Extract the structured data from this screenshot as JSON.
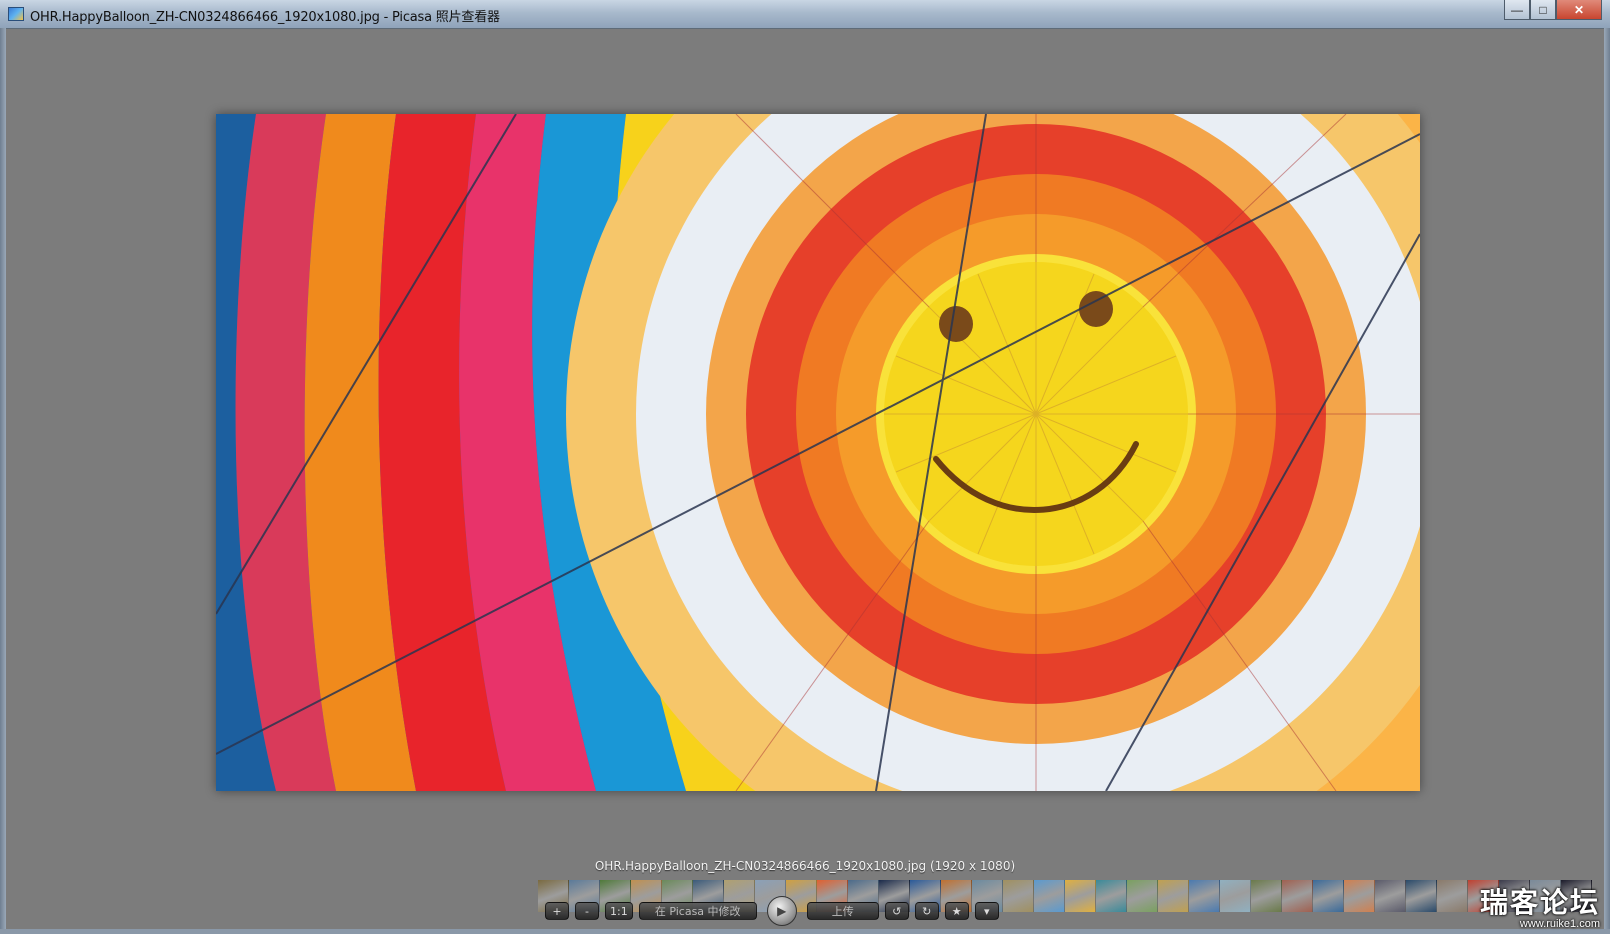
{
  "window": {
    "title": "OHR.HappyBalloon_ZH-CN0324866466_1920x1080.jpg - Picasa 照片查看器",
    "minimize": "—",
    "maximize": "□",
    "close": "✕"
  },
  "viewer": {
    "caption": "OHR.HappyBalloon_ZH-CN0324866466_1920x1080.jpg (1920 x 1080)"
  },
  "controls": {
    "zoom_in": "+",
    "zoom_out": "-",
    "actual_size": "1:1",
    "edit_in_picasa": "在 Picasa 中修改",
    "play": "▶",
    "upload": "上传",
    "rotate_left": "↺",
    "rotate_right": "↻",
    "star": "★",
    "more": "▾"
  },
  "filmstrip": {
    "thumb_colors": [
      "#7a6a40",
      "#5a7a9a",
      "#4f7a3a",
      "#c09050",
      "#6a8a5a",
      "#3a5a7a",
      "#b0a070",
      "#8aa0b8",
      "#d0a040",
      "#e06030",
      "#4a6a8a",
      "#1a2a4a",
      "#2a5a9a",
      "#c07030",
      "#6a8aa0",
      "#a09060",
      "#5a9ad0",
      "#e0b040",
      "#3a8a9a",
      "#7aa060",
      "#c0a050",
      "#4a7ab0",
      "#90b0c0",
      "#6a7a4a",
      "#a06050",
      "#3a6a9a",
      "#d08050",
      "#5a5a6a",
      "#2a4a6a",
      "#8a7a6a",
      "#c04030",
      "#3a3a4a",
      "#7a8a9a",
      "#1a1a2a"
    ]
  },
  "watermark": {
    "line1": "瑞客论坛",
    "line2": "www.ruike1.com"
  },
  "colors": {
    "background": "#7c7c7c",
    "caption": "#f2f2f2"
  }
}
